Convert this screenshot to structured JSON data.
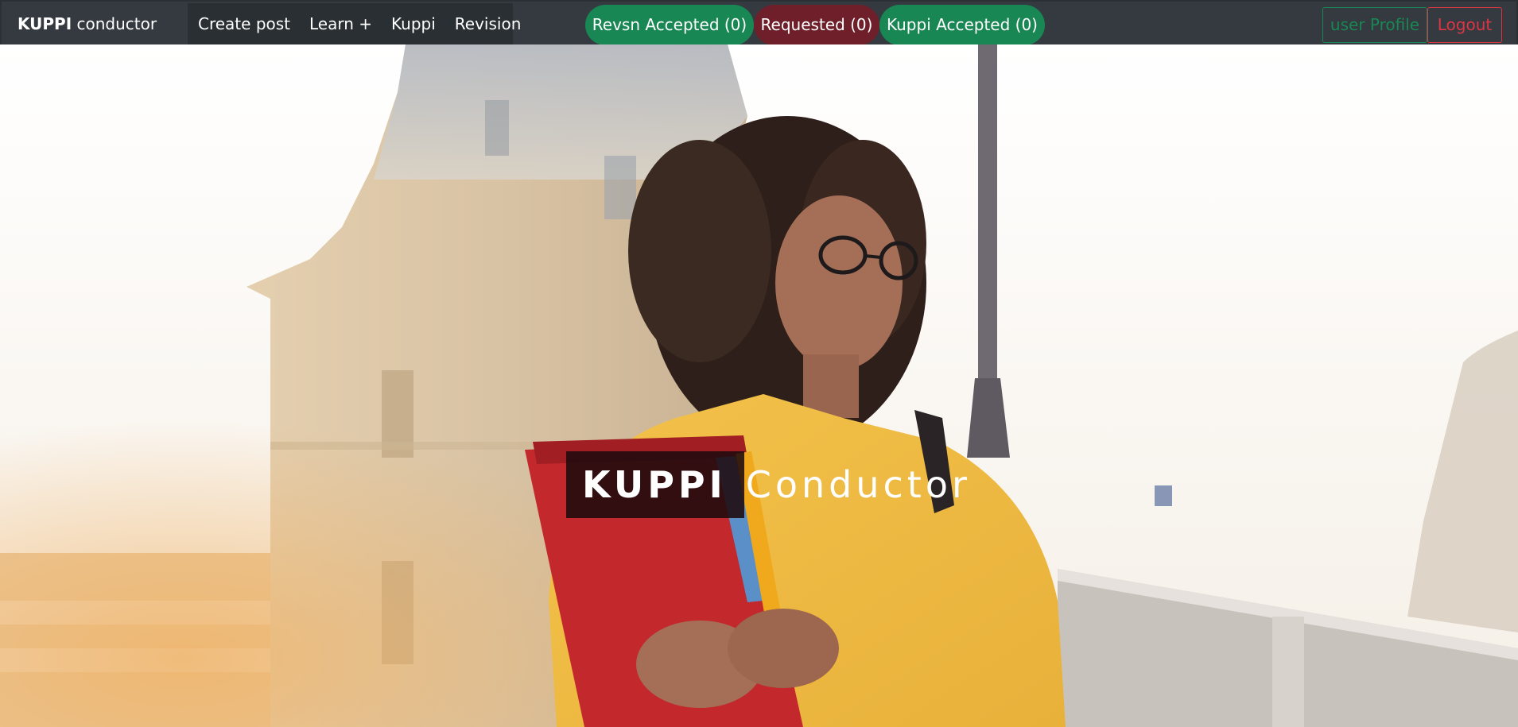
{
  "navbar": {
    "brand_bold": "KUPPI",
    "brand_rest": " conductor",
    "links": [
      {
        "label": "Create post"
      },
      {
        "label": "Learn +"
      },
      {
        "label": "Kuppi"
      },
      {
        "label": "Revision"
      }
    ],
    "pills": {
      "revsn_accepted": "Revsn Accepted (0)",
      "requested": "Requested (0)",
      "kuppi_accepted": "Kuppi Accepted (0)"
    },
    "user_profile": "user Profile",
    "logout": "Logout"
  },
  "hero": {
    "title_bold": "KUPPI",
    "title_rest": " Conductor"
  },
  "colors": {
    "navbar_bg": "#343a40",
    "success": "#198754",
    "danger": "#dc3545",
    "requested_bg": "#6e1f2a"
  }
}
